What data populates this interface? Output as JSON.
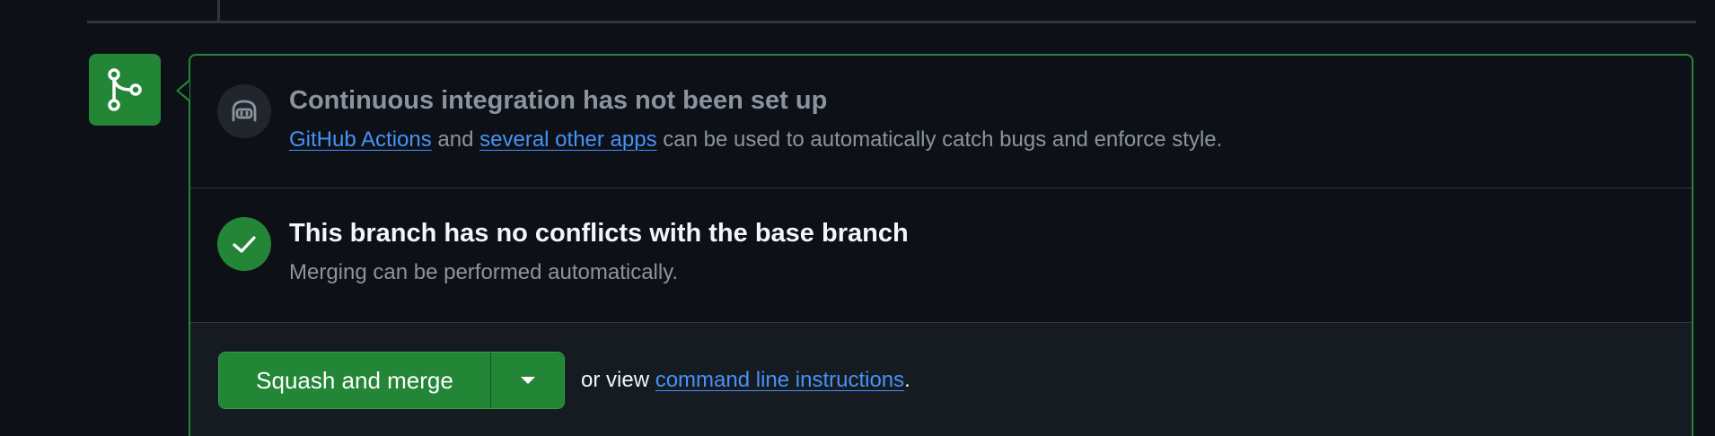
{
  "colors": {
    "background": "#0d1117",
    "success": "#238636",
    "link": "#4493f8",
    "muted_text": "#8b949e",
    "border": "#30363d"
  },
  "badge": {
    "icon": "git-merge-icon"
  },
  "ci": {
    "icon": "copilot-bot-icon",
    "heading": "Continuous integration has not been set up",
    "link_actions": "GitHub Actions",
    "text_and": " and ",
    "link_apps": "several other apps",
    "text_rest": " can be used to automatically catch bugs and enforce style."
  },
  "conflicts": {
    "icon": "check-icon",
    "heading": "This branch has no conflicts with the base branch",
    "description": "Merging can be performed automatically."
  },
  "merge": {
    "button_label": "Squash and merge",
    "dropdown_icon": "triangle-down-icon",
    "alt_prefix": "or view ",
    "alt_link": "command line instructions",
    "alt_suffix": "."
  }
}
